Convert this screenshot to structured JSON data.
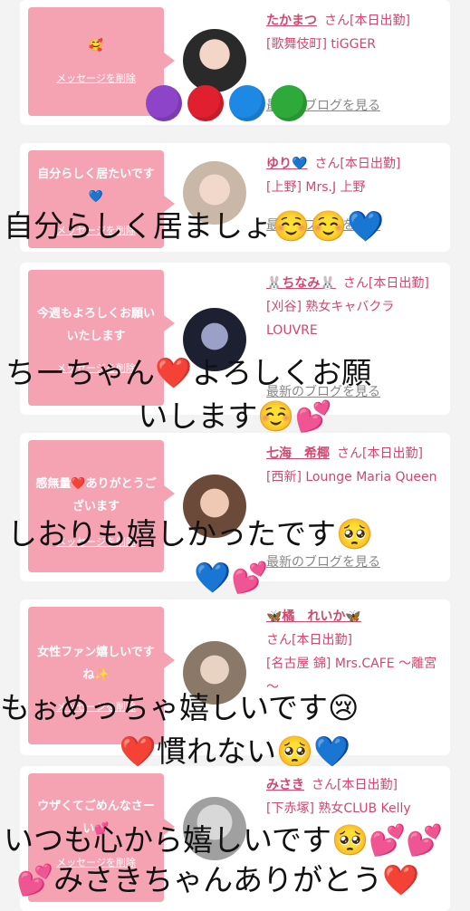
{
  "cards": [
    {
      "message": "🥰",
      "delete_label": "メッセージを削除",
      "name": "たかまつ",
      "honorific": "さん[本日出勤]",
      "venue": "[歌舞伎町] tiGGER",
      "blog": "最新のブログを見る"
    },
    {
      "message": "自分らしく居たいです💙",
      "delete_label": "メッセージを削除",
      "name": "ゆり💙",
      "honorific": "さん[本日出勤]",
      "venue": "[上野] Mrs.J 上野",
      "blog": "最新のブログを見る"
    },
    {
      "message": "今週もよろしくお願いいたします",
      "delete_label": "メッセージを削除",
      "name": "🐰ちなみ🐰",
      "honorific": "さん[本日出勤]",
      "venue": "[刈谷] 熟女キャバクラ LOUVRE",
      "blog": "最新のブログを見る"
    },
    {
      "message": "感無量❤️ありがとうございます",
      "delete_label": "メッセージを削除",
      "name": "七海　希椰",
      "honorific": "さん[本日出勤]",
      "venue": "[西新] Lounge Maria Queen",
      "blog": "最新のブログを見る"
    },
    {
      "message": "女性ファン嬉しいですね✨",
      "delete_label": "メッセージを削除",
      "name": "🦋橘　れいか🦋",
      "honorific": "さん[本日出勤]",
      "venue": "[名古屋 錦] Mrs.CAFE ～離宮～",
      "blog": "最新のブログを見る"
    },
    {
      "message": "ウザくてごめんなさーい💕",
      "delete_label": "メッセージを削除",
      "name": "みさき",
      "honorific": "さん[本日出勤]",
      "venue": "[下赤塚] 熟女CLUB Kelly",
      "blog": "最新のブログを見る"
    }
  ],
  "overlays": {
    "o1": "自分らしく居ましょ☺️☺️💙",
    "o2": "ちーちゃん❤️よろしくお願",
    "o3": "いします☺️💕",
    "o4": "しおりも嬉しかったです🥺",
    "o5": "💙💕",
    "o6": "もぉめっちゃ嬉しいです😢",
    "o7": "❤️慣れない🥺💙",
    "o8": "いつも心から嬉しいです🥺💕💕",
    "o9": "💕みさきちゃんありがとう❤️"
  },
  "colors": {
    "bubble": "#f5a3b3",
    "name": "#d2476e",
    "heart_purple": "#8e44c9",
    "heart_red": "#e0202e",
    "heart_blue": "#1e88e5",
    "heart_green": "#2eaa3a"
  }
}
